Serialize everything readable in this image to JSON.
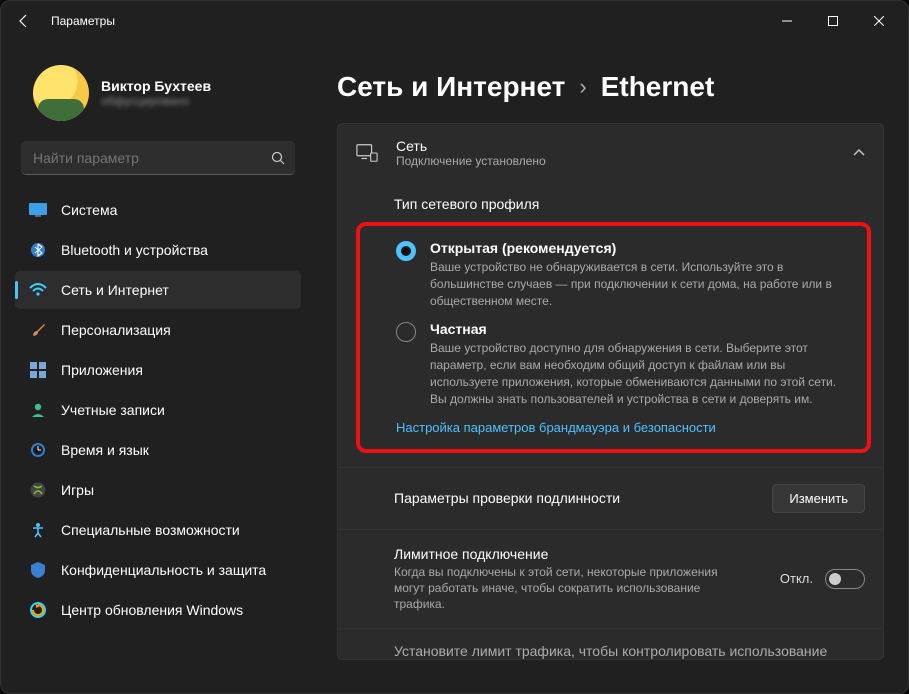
{
  "window": {
    "title": "Параметры"
  },
  "profile": {
    "name": "Виктор Бухтеев",
    "email": "обфусцировано"
  },
  "search": {
    "placeholder": "Найти параметр"
  },
  "nav": [
    {
      "id": "system",
      "label": "Система"
    },
    {
      "id": "bluetooth",
      "label": "Bluetooth и устройства"
    },
    {
      "id": "network",
      "label": "Сеть и Интернет"
    },
    {
      "id": "personalization",
      "label": "Персонализация"
    },
    {
      "id": "apps",
      "label": "Приложения"
    },
    {
      "id": "accounts",
      "label": "Учетные записи"
    },
    {
      "id": "time",
      "label": "Время и язык"
    },
    {
      "id": "gaming",
      "label": "Игры"
    },
    {
      "id": "accessibility",
      "label": "Специальные возможности"
    },
    {
      "id": "privacy",
      "label": "Конфиденциальность и защита"
    },
    {
      "id": "update",
      "label": "Центр обновления Windows"
    }
  ],
  "breadcrumb": {
    "parent": "Сеть и Интернет",
    "sep": "›",
    "current": "Ethernet"
  },
  "network_card": {
    "title": "Сеть",
    "subtitle": "Подключение установлено"
  },
  "profile_type": {
    "heading": "Тип сетевого профиля",
    "open": {
      "title": "Открытая (рекомендуется)",
      "desc": "Ваше устройство не обнаруживается в сети. Используйте это в большинстве случаев — при подключении к сети дома, на работе или в общественном месте."
    },
    "private": {
      "title": "Частная",
      "desc": "Ваше устройство доступно для обнаружения в сети. Выберите этот параметр, если вам необходим общий доступ к файлам или вы используете приложения, которые обмениваются данными по этой сети. Вы должны знать пользователей и устройства в сети и доверять им."
    },
    "firewall_link": "Настройка параметров брандмауэра и безопасности"
  },
  "auth": {
    "title": "Параметры проверки подлинности",
    "button": "Изменить"
  },
  "metered": {
    "title": "Лимитное подключение",
    "desc": "Когда вы подключены к этой сети, некоторые приложения могут работать иначе, чтобы сократить использование трафика.",
    "state": "Откл."
  },
  "cutoff": {
    "text": "Установите лимит трафика, чтобы контролировать использование"
  }
}
